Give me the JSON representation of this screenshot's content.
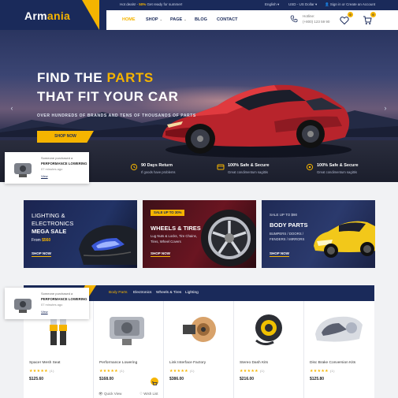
{
  "colors": {
    "navy": "#1a2a5a",
    "accent": "#f5b400",
    "white": "#ffffff"
  },
  "topbar": {
    "promo_prefix": "Hot deals! - ",
    "promo_highlight": "50%",
    "promo_suffix": " Get ready for summer!",
    "language": "English",
    "currency": "USD - US Dollar",
    "account": "Sign in or Create an Account"
  },
  "logo": {
    "part1": "Arm",
    "part2": "ania"
  },
  "nav": {
    "items": [
      {
        "label": "HOME",
        "active": true
      },
      {
        "label": "SHOP",
        "dropdown": true
      },
      {
        "label": "PAGE",
        "dropdown": true
      },
      {
        "label": "BLOG"
      },
      {
        "label": "CONTACT"
      }
    ]
  },
  "header": {
    "hotline_label": "Hotline:",
    "hotline_number": "(+800) 123 59 90",
    "wishlist_count": "0",
    "cart_count": "0",
    "icons": [
      "phone-icon",
      "heart-icon",
      "cart-icon"
    ]
  },
  "hero": {
    "title_part1": "FIND THE ",
    "title_highlight": "PARTS",
    "title_line2": "THAT FIT YOUR CAR",
    "subtitle": "OVER HUNDREDS OF BRANDS AND TENS OF THOUSANDS OF PARTS",
    "button": "SHOP NOW",
    "prev": "‹",
    "next": "›"
  },
  "features": [
    {
      "title": "90 Days Return",
      "sub": "If goods have problems",
      "icon": "return-icon"
    },
    {
      "title": "100% Safe & Secure",
      "sub": "Great condimentum sagittis",
      "icon": "shield-icon"
    },
    {
      "title": "100% Safe & Secure",
      "sub": "Great condimentum sagittis",
      "icon": "support-icon"
    }
  ],
  "toast": {
    "line1": "Someone purchased a",
    "product": "PERFORMANCE LOWERING",
    "time": "07 minutes ago",
    "link": "View",
    "close": "×"
  },
  "banners": {
    "lighting": {
      "line1": "LIGHTING &",
      "line2": "ELECTRONICS",
      "line3": "MEGA SALE",
      "price_prefix": "From ",
      "price": "$560",
      "link": "SHOP NOW"
    },
    "wheels": {
      "tag": "SALE UP TO 30%",
      "title": "WHEELS & TIRES",
      "desc1": "Lug Nuts & Locks, Tire Chains,",
      "desc2": "Tires, Wheel Covers",
      "link": "SHOP NOW"
    },
    "body": {
      "tag": "SALE UP TO $90",
      "title": "BODY PARTS",
      "desc1": "BUMPERS / DOORS /",
      "desc2": "FENDERS / MIRRORS",
      "link": "SHOP NOW"
    }
  },
  "products": {
    "tabs": [
      {
        "label": "Body Parts",
        "active": true
      },
      {
        "label": "Electronics"
      },
      {
        "label": "Wheels & Tires"
      },
      {
        "label": "Lighting"
      }
    ],
    "items": [
      {
        "name": "Spacer Mesh Seat",
        "rating": 5,
        "count": "(1)",
        "price": "$125.60"
      },
      {
        "name": "Performance Lowering",
        "rating": 5,
        "count": "(1)",
        "price": "$168.00"
      },
      {
        "name": "Link Interface Factory",
        "rating": 5,
        "count": "(1)",
        "price": "$386.00"
      },
      {
        "name": "Stereo Dash Kits",
        "rating": 5,
        "count": "(1)",
        "price": "$216.00"
      },
      {
        "name": "Disc Brake Conversion Kits",
        "rating": 5,
        "count": "(1)",
        "price": "$125.80"
      }
    ],
    "quick_view": "Quick View",
    "wish_list": "Wish List"
  }
}
